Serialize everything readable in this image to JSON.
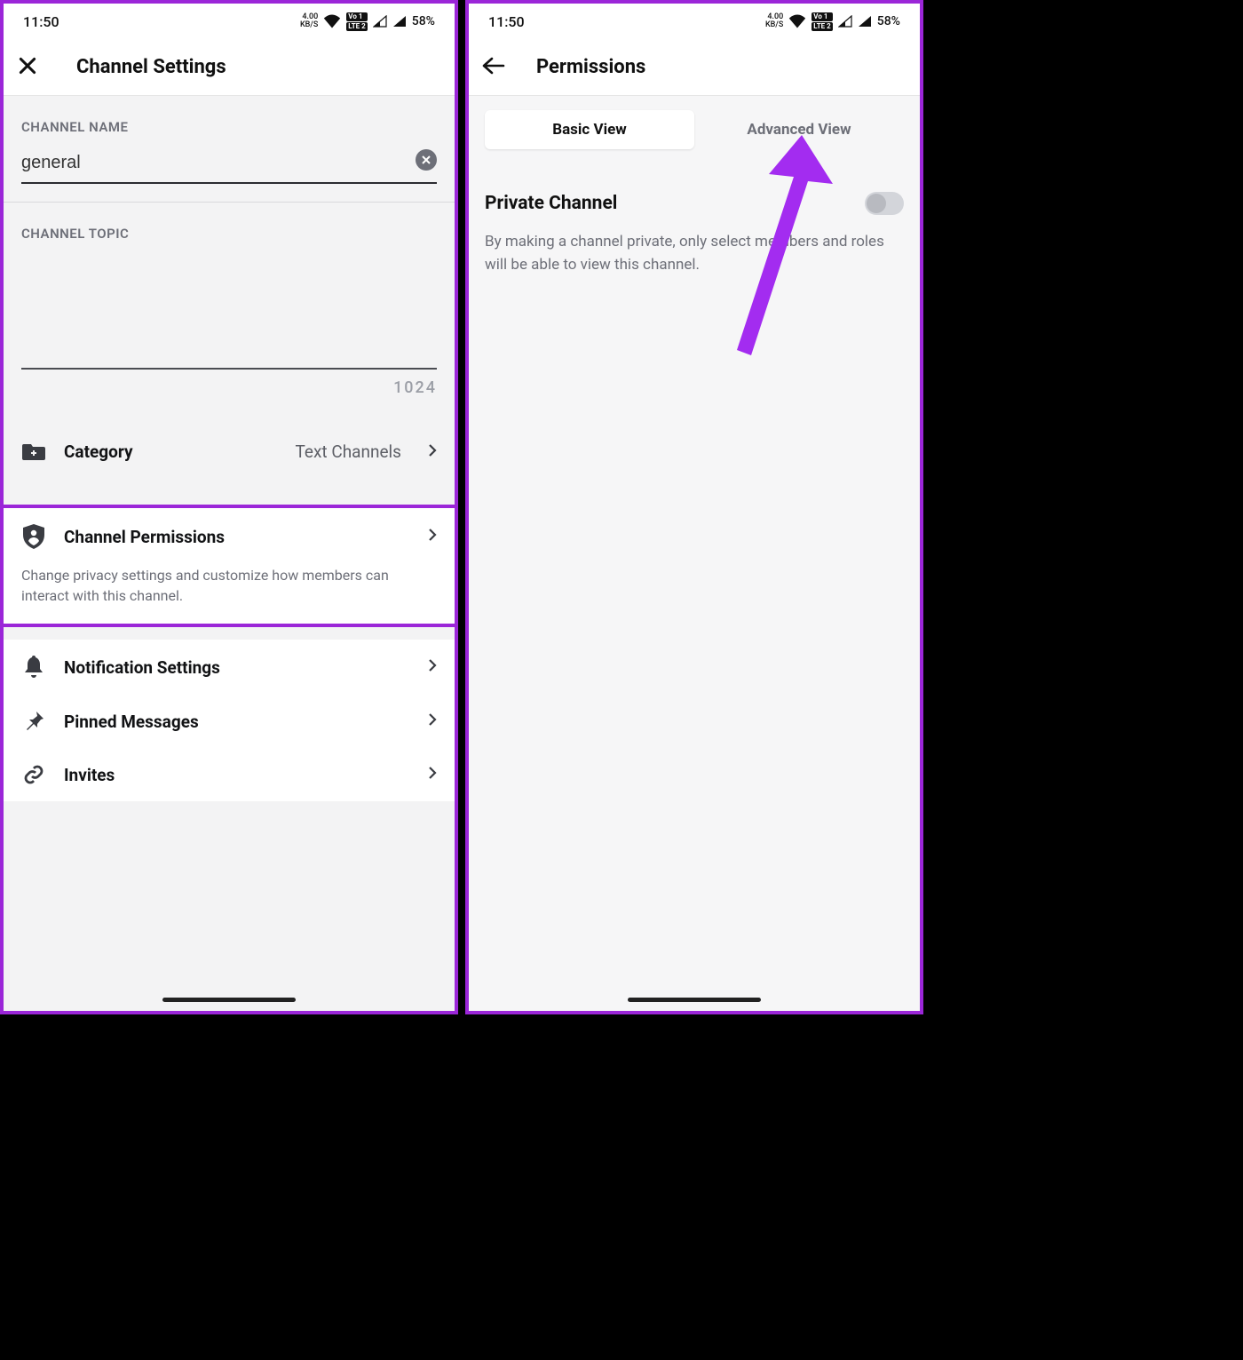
{
  "status": {
    "time": "11:50",
    "kbs_value": "4.00",
    "kbs_unit": "KB/S",
    "lte1": "Vo 1",
    "lte2": "LTE 2",
    "battery": "58%"
  },
  "left": {
    "title": "Channel Settings",
    "channel_name_label": "CHANNEL NAME",
    "channel_name_value": "general",
    "channel_topic_label": "CHANNEL TOPIC",
    "topic_value": "",
    "topic_limit": "1024",
    "rows": {
      "category": {
        "label": "Category",
        "value": "Text Channels"
      },
      "permissions": {
        "label": "Channel Permissions",
        "desc": "Change privacy settings and customize how members can interact with this channel."
      },
      "notifications": {
        "label": "Notification Settings"
      },
      "pinned": {
        "label": "Pinned Messages"
      },
      "invites": {
        "label": "Invites"
      }
    }
  },
  "right": {
    "title": "Permissions",
    "tabs": {
      "basic": "Basic View",
      "advanced": "Advanced View"
    },
    "private": {
      "title": "Private Channel",
      "desc": "By making a channel private, only select members and roles will be able to view this channel."
    }
  }
}
